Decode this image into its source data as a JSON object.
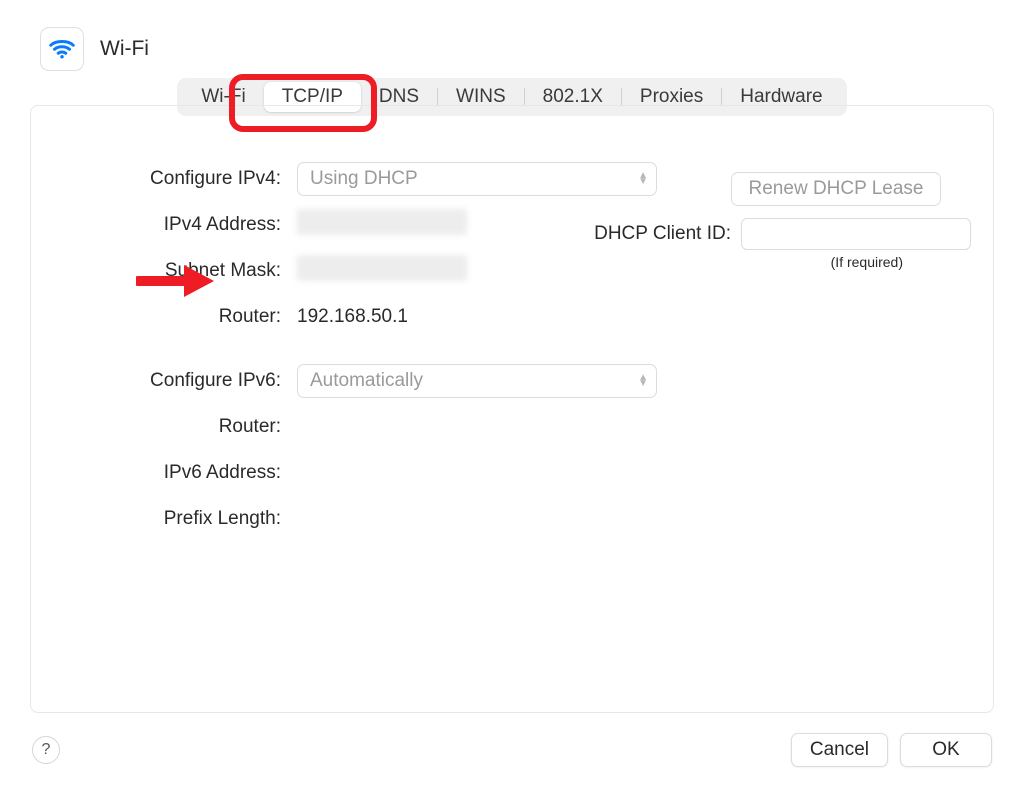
{
  "header": {
    "title": "Wi-Fi"
  },
  "tabs": [
    {
      "label": "Wi-Fi",
      "active": false
    },
    {
      "label": "TCP/IP",
      "active": true
    },
    {
      "label": "DNS",
      "active": false
    },
    {
      "label": "WINS",
      "active": false
    },
    {
      "label": "802.1X",
      "active": false
    },
    {
      "label": "Proxies",
      "active": false
    },
    {
      "label": "Hardware",
      "active": false
    }
  ],
  "ipv4": {
    "configure_label": "Configure IPv4:",
    "configure_value": "Using DHCP",
    "address_label": "IPv4 Address:",
    "address_value": "",
    "subnet_label": "Subnet Mask:",
    "subnet_value": "",
    "router_label": "Router:",
    "router_value": "192.168.50.1"
  },
  "dhcp": {
    "renew_button": "Renew DHCP Lease",
    "client_id_label": "DHCP Client ID:",
    "client_id_value": "",
    "hint": "(If required)"
  },
  "ipv6": {
    "configure_label": "Configure IPv6:",
    "configure_value": "Automatically",
    "router_label": "Router:",
    "router_value": "",
    "address_label": "IPv6 Address:",
    "address_value": "",
    "prefix_label": "Prefix Length:",
    "prefix_value": ""
  },
  "footer": {
    "help": "?",
    "cancel": "Cancel",
    "ok": "OK"
  }
}
